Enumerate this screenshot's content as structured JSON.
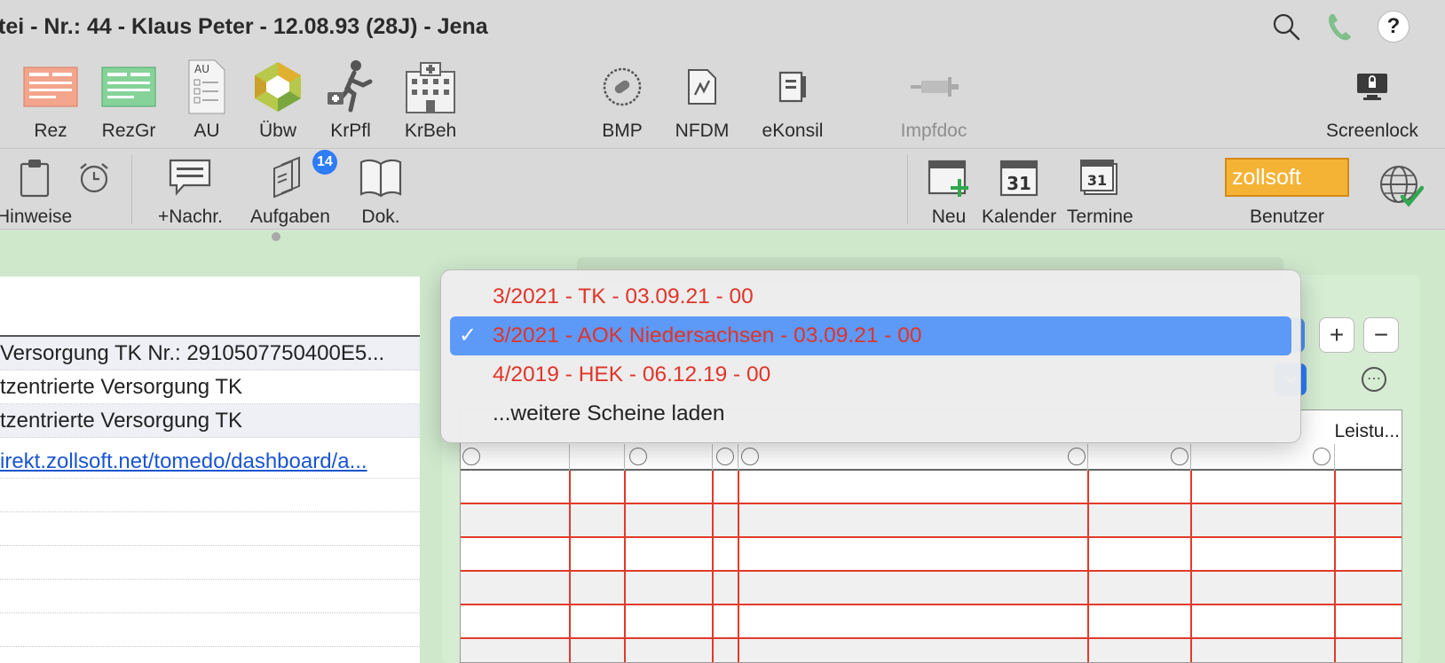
{
  "window": {
    "title": "tei - Nr.: 44 - Klaus Peter - 12.08.93 (28J) - Jena"
  },
  "toolbar_top": [
    {
      "key": "rez",
      "label": "Rez"
    },
    {
      "key": "rezgr",
      "label": "RezGr"
    },
    {
      "key": "au",
      "label": "AU",
      "icon_text": "AU"
    },
    {
      "key": "uebw",
      "label": "Übw"
    },
    {
      "key": "krpfl",
      "label": "KrPfl"
    },
    {
      "key": "krbeh",
      "label": "KrBeh"
    },
    {
      "key": "bmp",
      "label": "BMP"
    },
    {
      "key": "nfdm",
      "label": "NFDM"
    },
    {
      "key": "ekonsil",
      "label": "eKonsil"
    },
    {
      "key": "impfdoc",
      "label": "Impfdoc",
      "disabled": true
    },
    {
      "key": "screenlock",
      "label": "Screenlock"
    }
  ],
  "toolbar_second": {
    "hinweise": "Hinweise",
    "nachr": "+Nachr.",
    "aufgaben": "Aufgaben",
    "aufgaben_badge": "14",
    "dok": "Dok.",
    "neu": "Neu",
    "kalender": "Kalender",
    "kalender_day": "31",
    "termine": "Termine",
    "termine_day": "31",
    "benutzer_logo": "zollsoft",
    "benutzer": "Benutzer"
  },
  "left_list": {
    "rows": [
      "Versorgung TK Nr.: 2910507750400E5...",
      "tzentrierte Versorgung TK",
      "tzentrierte Versorgung TK"
    ],
    "link": "irekt.zollsoft.net/tomedo/dashboard/a..."
  },
  "grid": {
    "last_column_header": "Leistu..."
  },
  "popup_menu": {
    "items": [
      {
        "label": "3/2021 - TK - 03.09.21 - 00",
        "style": "red",
        "selected": false
      },
      {
        "label": "3/2021 - AOK Niedersachsen - 03.09.21 - 00",
        "style": "red",
        "selected": true
      },
      {
        "label": "4/2019 - HEK - 06.12.19 - 00",
        "style": "red",
        "selected": false
      },
      {
        "label": "...weitere Scheine laden",
        "style": "normal",
        "selected": false
      }
    ],
    "check_glyph": "✓"
  },
  "controls": {
    "plus": "+",
    "minus": "−"
  },
  "colors": {
    "selection": "#5d99f6",
    "menu_red": "#e0342a",
    "grid_line_red": "#e23a2a",
    "panel_green": "#cfe8cc",
    "badge_blue": "#2e7cf6",
    "zollsoft_orange": "#f5b336"
  }
}
